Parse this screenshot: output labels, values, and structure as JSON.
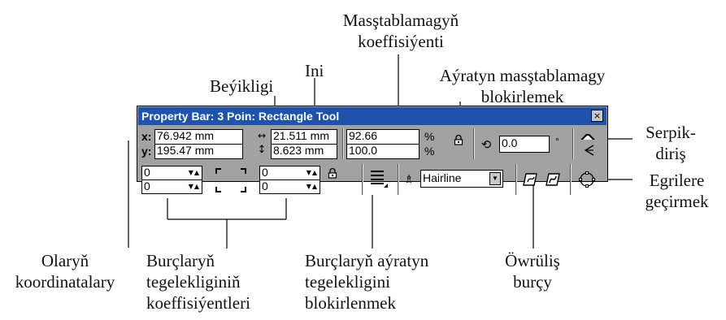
{
  "titlebar": {
    "title": "Property Bar: 3 Poin: Rectangle Tool",
    "close": "×"
  },
  "position": {
    "x_label": "x:",
    "y_label": "y:",
    "x": "76.942 mm",
    "y": "195.47 mm"
  },
  "size": {
    "width": "21.511 mm",
    "height": "8.623 mm"
  },
  "scale": {
    "width": "92.66",
    "height": "100.0",
    "unit": "%"
  },
  "rotation": {
    "value": "0.0",
    "unit": "°"
  },
  "corners": {
    "top_left": "0",
    "bottom_left": "0",
    "top_right": "0",
    "bottom_right": "0"
  },
  "outline": {
    "selected": "Hairline"
  },
  "annotations": {
    "scale_factor": [
      "Masştablamagyň",
      "koeffisiýenti"
    ],
    "width": "Ini",
    "height": "Beýikligi",
    "lock_scale": [
      "Aýratyn masştablamagy",
      "blokirlemek"
    ],
    "mirror": [
      "Serpik-",
      "diriş"
    ],
    "convert": [
      "Egrilere",
      "geçirmek"
    ],
    "coordinates": [
      "Olaryň",
      "koordinatalary"
    ],
    "corner_roundness": [
      "Burçlaryň",
      "tegelekliginiň",
      "koeffisiýentleri"
    ],
    "lock_corners": [
      "Burçlaryň aýratyn",
      "tegelekligini",
      "blokirlenmek"
    ],
    "rotation_angle": [
      "Öwrüliş",
      "burçy"
    ]
  },
  "icons": [
    "width-arrows-icon",
    "height-arrows-icon",
    "lock-icon",
    "rotate-icon",
    "mirror-icon",
    "wrap-text-icon",
    "outline-pen-icon",
    "dropdown-icon",
    "convert-curves-icon",
    "ellipse-icon"
  ]
}
